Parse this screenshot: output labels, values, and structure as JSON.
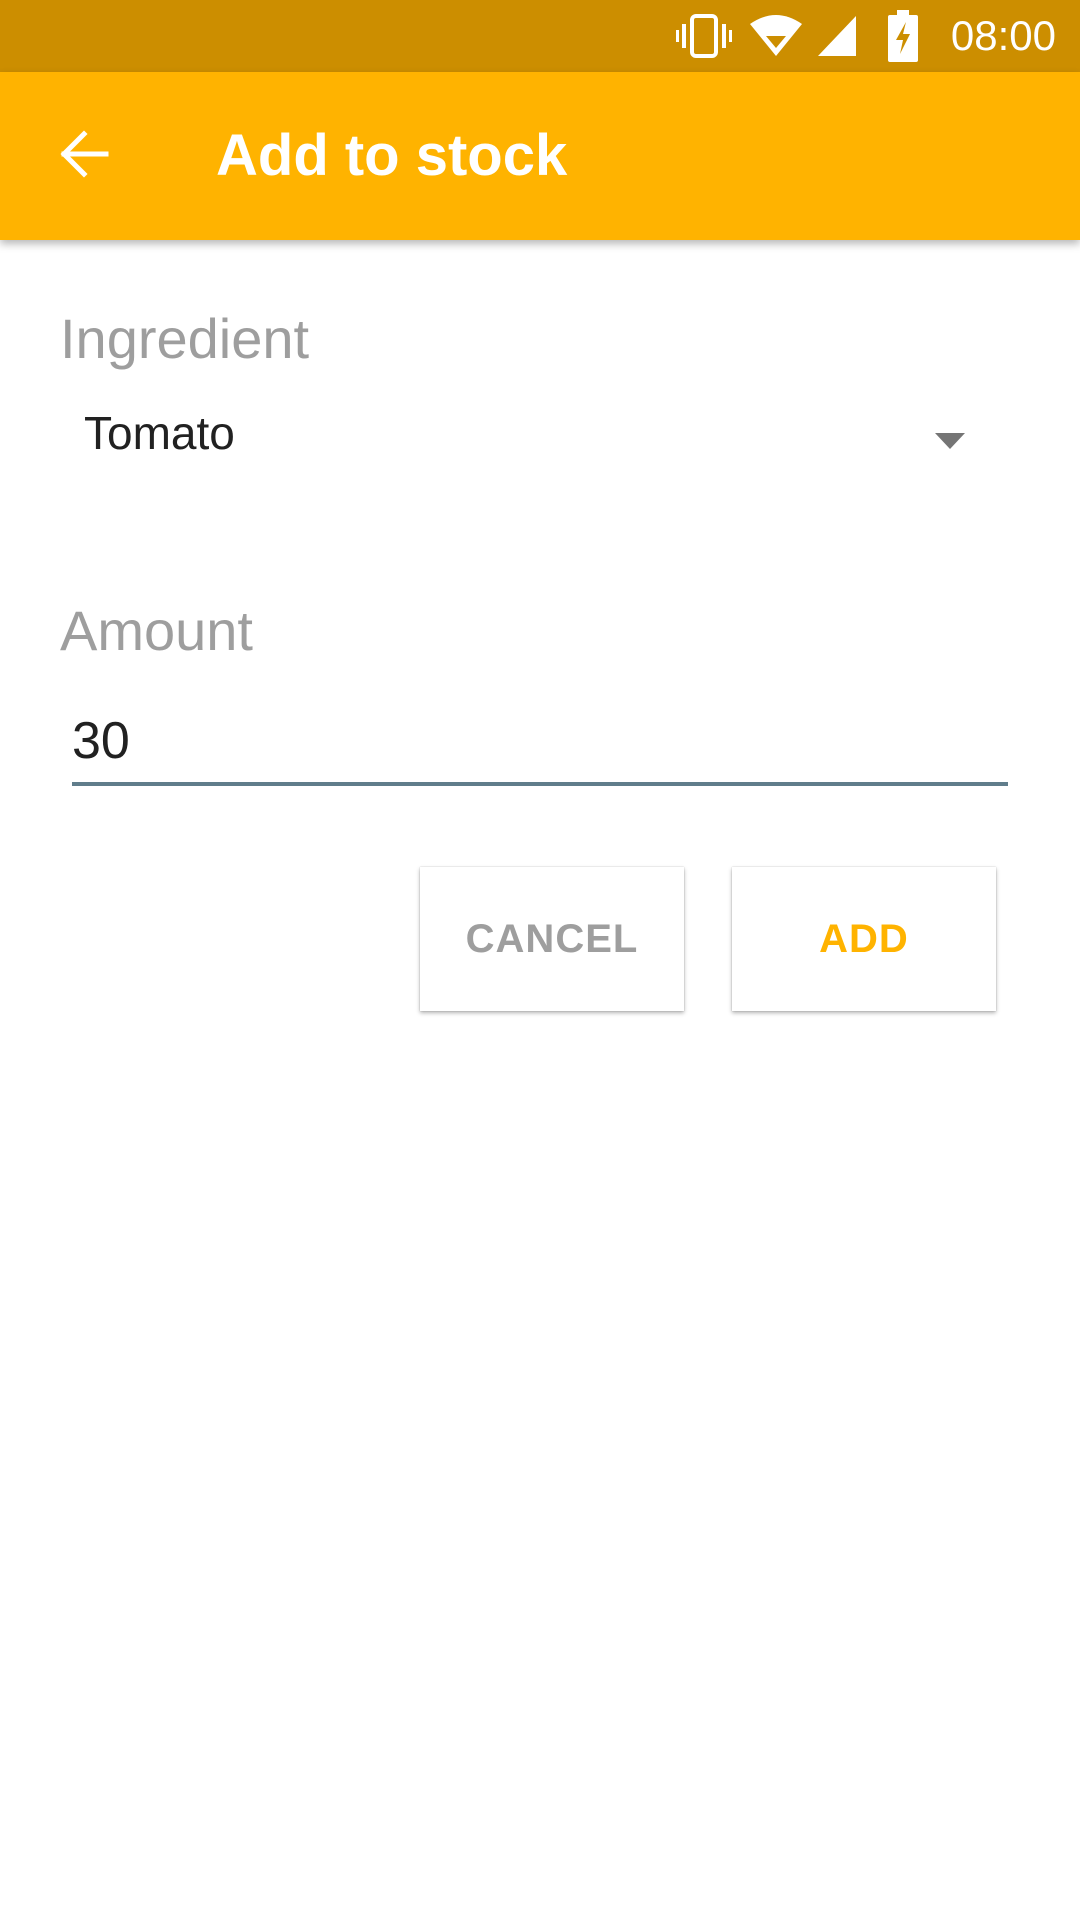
{
  "status_bar": {
    "time": "08:00",
    "icons": [
      "vibrate-icon",
      "wifi-icon",
      "cellular-signal-icon",
      "battery-charging-icon"
    ]
  },
  "toolbar": {
    "back_icon": "arrow-back-icon",
    "title": "Add to stock"
  },
  "form": {
    "ingredient_label": "Ingredient",
    "ingredient_value": "Tomato",
    "amount_label": "Amount",
    "amount_value": "30"
  },
  "actions": {
    "cancel_label": "CANCEL",
    "add_label": "ADD"
  },
  "colors": {
    "primary": "#ffb300",
    "primary_dark": "#cc8e00",
    "input_underline": "#607d8b",
    "label_gray": "#9e9e9e"
  }
}
